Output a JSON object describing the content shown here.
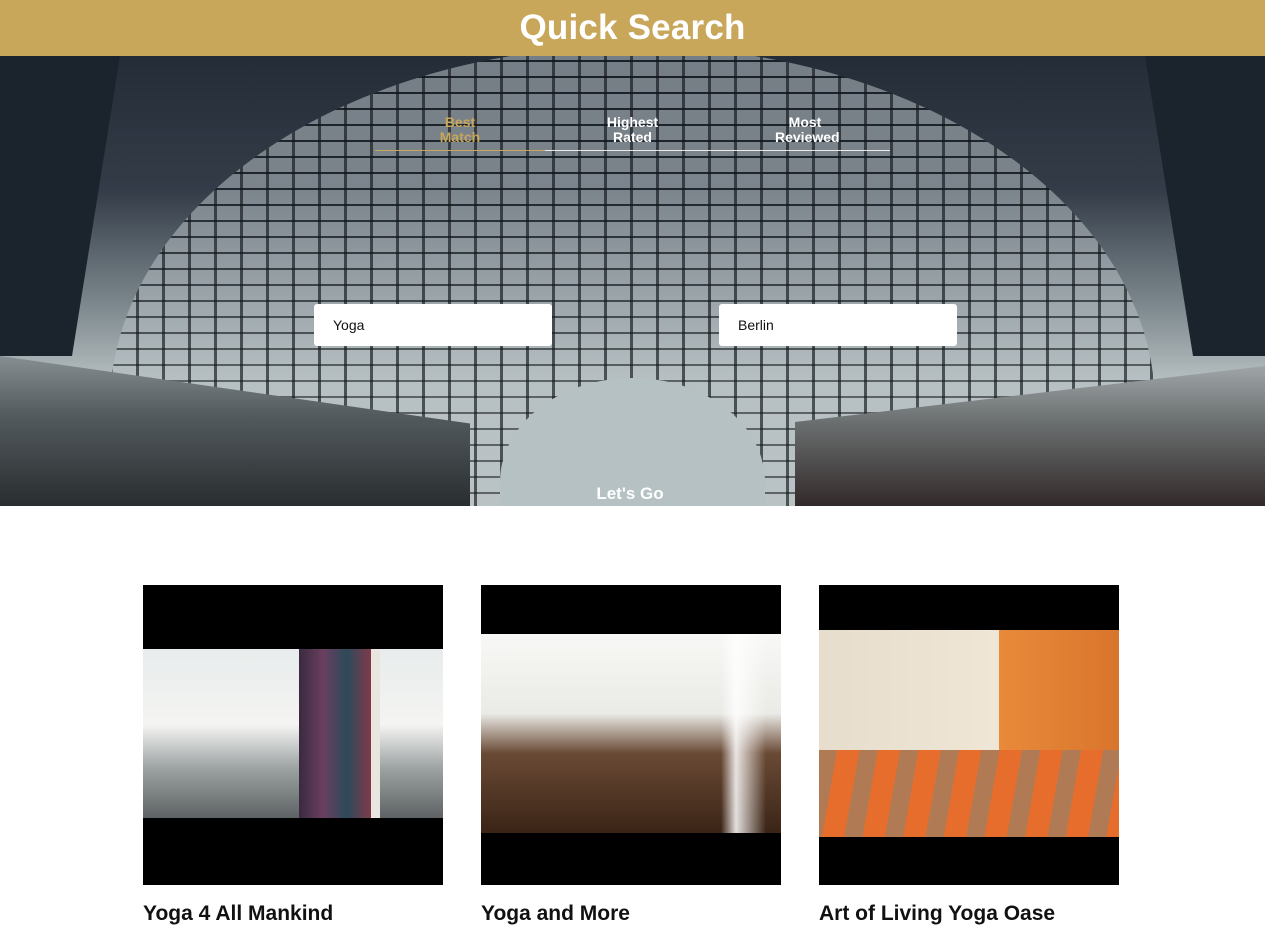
{
  "header": {
    "title": "Quick Search"
  },
  "tabs": [
    {
      "line1": "Best",
      "line2": "Match",
      "active": true
    },
    {
      "line1": "Highest",
      "line2": "Rated",
      "active": false
    },
    {
      "line1": "Most",
      "line2": "Reviewed",
      "active": false
    }
  ],
  "search": {
    "what_value": "Yoga",
    "where_value": "Berlin",
    "submit_label": "Let's Go"
  },
  "results": [
    {
      "name": "Yoga 4 All Mankind"
    },
    {
      "name": "Yoga and More"
    },
    {
      "name": "Art of Living Yoga Oase"
    }
  ],
  "colors": {
    "accent": "#c8a65a"
  }
}
